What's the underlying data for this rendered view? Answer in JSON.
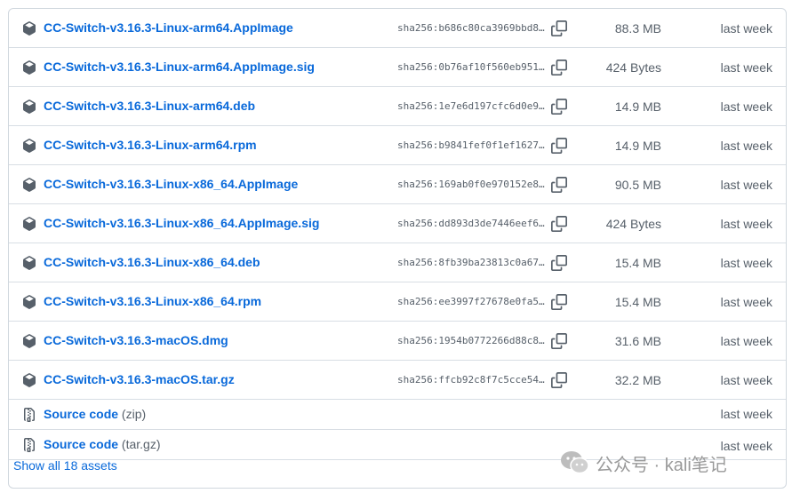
{
  "assets": [
    {
      "name": "CC-Switch-v3.16.3-Linux-arm64.AppImage",
      "hash": "sha256:b686c80ca3969bbd8…",
      "size": "88.3 MB",
      "date": "last week"
    },
    {
      "name": "CC-Switch-v3.16.3-Linux-arm64.AppImage.sig",
      "hash": "sha256:0b76af10f560eb951…",
      "size": "424 Bytes",
      "date": "last week"
    },
    {
      "name": "CC-Switch-v3.16.3-Linux-arm64.deb",
      "hash": "sha256:1e7e6d197cfc6d0e9…",
      "size": "14.9 MB",
      "date": "last week"
    },
    {
      "name": "CC-Switch-v3.16.3-Linux-arm64.rpm",
      "hash": "sha256:b9841fef0f1ef1627…",
      "size": "14.9 MB",
      "date": "last week"
    },
    {
      "name": "CC-Switch-v3.16.3-Linux-x86_64.AppImage",
      "hash": "sha256:169ab0f0e970152e8…",
      "size": "90.5 MB",
      "date": "last week"
    },
    {
      "name": "CC-Switch-v3.16.3-Linux-x86_64.AppImage.sig",
      "hash": "sha256:dd893d3de7446eef6…",
      "size": "424 Bytes",
      "date": "last week"
    },
    {
      "name": "CC-Switch-v3.16.3-Linux-x86_64.deb",
      "hash": "sha256:8fb39ba23813c0a67…",
      "size": "15.4 MB",
      "date": "last week"
    },
    {
      "name": "CC-Switch-v3.16.3-Linux-x86_64.rpm",
      "hash": "sha256:ee3997f27678e0fa5…",
      "size": "15.4 MB",
      "date": "last week"
    },
    {
      "name": "CC-Switch-v3.16.3-macOS.dmg",
      "hash": "sha256:1954b0772266d88c8…",
      "size": "31.6 MB",
      "date": "last week"
    },
    {
      "name": "CC-Switch-v3.16.3-macOS.tar.gz",
      "hash": "sha256:ffcb92c8f7c5cce54…",
      "size": "32.2 MB",
      "date": "last week"
    }
  ],
  "source": [
    {
      "name": "Source code",
      "suffix": "(zip)",
      "date": "last week"
    },
    {
      "name": "Source code",
      "suffix": "(tar.gz)",
      "date": "last week"
    }
  ],
  "show_all": "Show all 18 assets",
  "watermark": "公众号 · kali笔记",
  "colors": {
    "link": "#0969da",
    "muted": "#57606a",
    "border": "#d0d7de"
  },
  "icons": {
    "asset": "package-icon",
    "source": "file-zip-icon",
    "copy": "copy-icon"
  }
}
